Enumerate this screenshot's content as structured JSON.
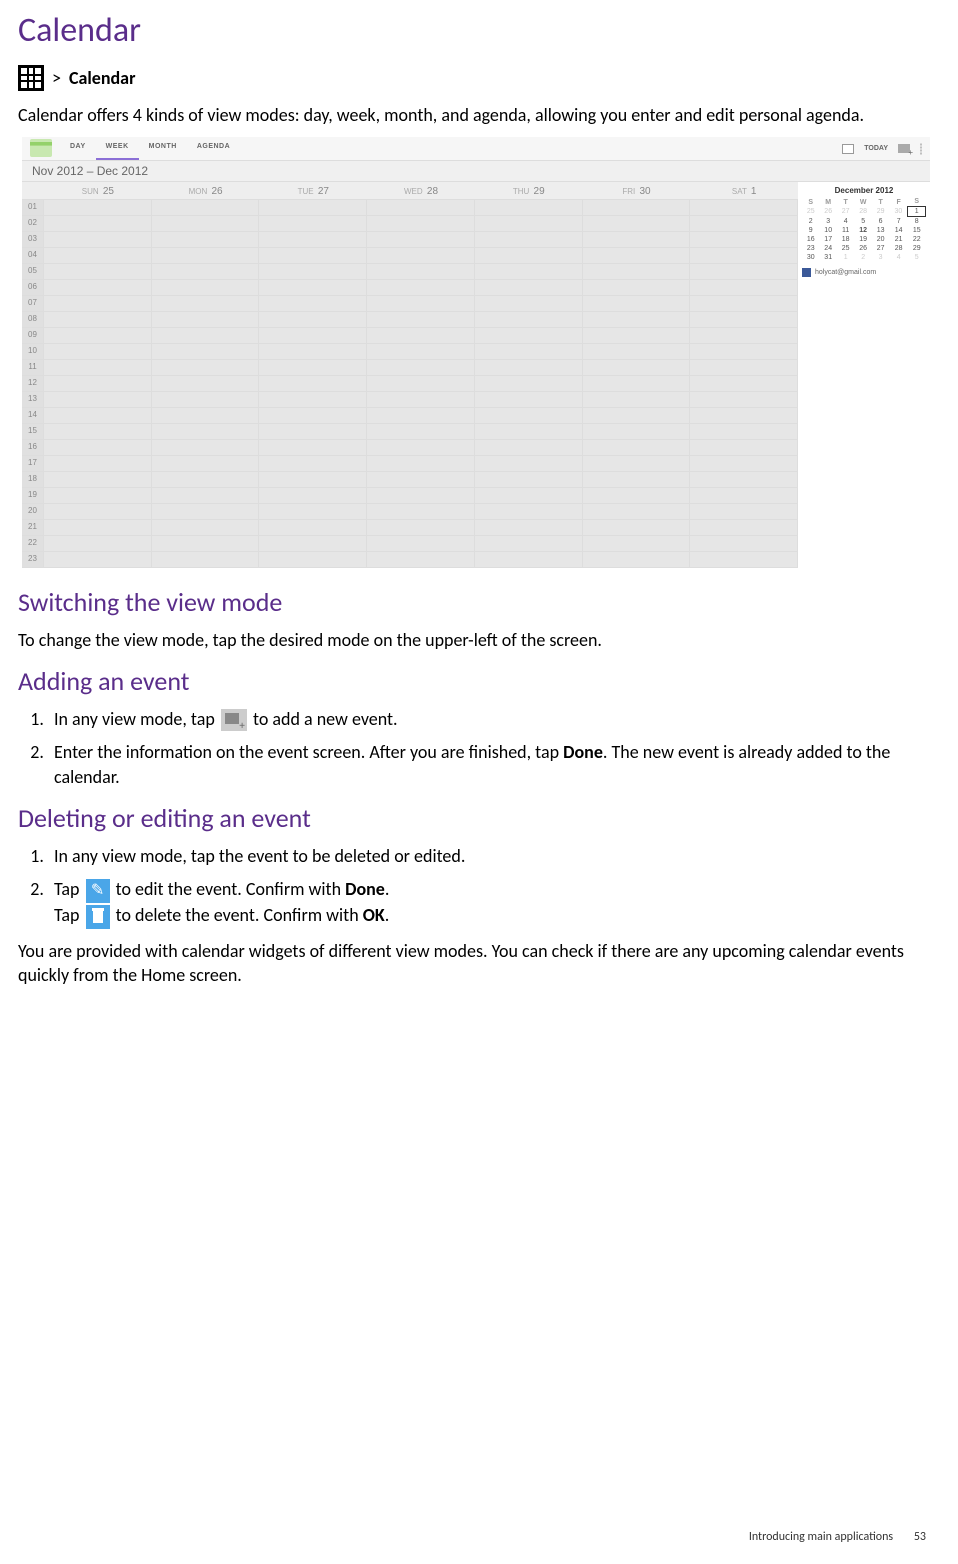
{
  "title": "Calendar",
  "path": {
    "sep": ">",
    "label": "Calendar"
  },
  "intro": "Calendar offers 4 kinds of view modes: day, week, month, and agenda, allowing you enter and edit personal agenda.",
  "screenshot": {
    "tabs": [
      "DAY",
      "WEEK",
      "MONTH",
      "AGENDA"
    ],
    "active_tab_index": 1,
    "today_label": "TODAY",
    "date_range": "Nov 2012 – Dec 2012",
    "days": [
      {
        "dow": "SUN",
        "num": "25"
      },
      {
        "dow": "MON",
        "num": "26"
      },
      {
        "dow": "TUE",
        "num": "27"
      },
      {
        "dow": "WED",
        "num": "28"
      },
      {
        "dow": "THU",
        "num": "29"
      },
      {
        "dow": "FRI",
        "num": "30"
      },
      {
        "dow": "SAT",
        "num": "1"
      }
    ],
    "hours": [
      "01",
      "02",
      "03",
      "04",
      "05",
      "06",
      "07",
      "08",
      "09",
      "10",
      "11",
      "12",
      "13",
      "14",
      "15",
      "16",
      "17",
      "18",
      "19",
      "20",
      "21",
      "22",
      "23"
    ],
    "mini": {
      "title": "December 2012",
      "dow": [
        "S",
        "M",
        "T",
        "W",
        "T",
        "F",
        "S"
      ],
      "rows": [
        [
          {
            "v": "25",
            "dim": true
          },
          {
            "v": "26",
            "dim": true
          },
          {
            "v": "27",
            "dim": true
          },
          {
            "v": "28",
            "dim": true
          },
          {
            "v": "29",
            "dim": true
          },
          {
            "v": "30",
            "dim": true
          },
          {
            "v": "1",
            "sel": true
          }
        ],
        [
          {
            "v": "2"
          },
          {
            "v": "3"
          },
          {
            "v": "4"
          },
          {
            "v": "5"
          },
          {
            "v": "6"
          },
          {
            "v": "7"
          },
          {
            "v": "8"
          }
        ],
        [
          {
            "v": "9"
          },
          {
            "v": "10"
          },
          {
            "v": "11"
          },
          {
            "v": "12",
            "bold": true
          },
          {
            "v": "13"
          },
          {
            "v": "14"
          },
          {
            "v": "15"
          }
        ],
        [
          {
            "v": "16"
          },
          {
            "v": "17"
          },
          {
            "v": "18"
          },
          {
            "v": "19"
          },
          {
            "v": "20"
          },
          {
            "v": "21"
          },
          {
            "v": "22"
          }
        ],
        [
          {
            "v": "23"
          },
          {
            "v": "24"
          },
          {
            "v": "25"
          },
          {
            "v": "26"
          },
          {
            "v": "27"
          },
          {
            "v": "28"
          },
          {
            "v": "29"
          }
        ],
        [
          {
            "v": "30"
          },
          {
            "v": "31"
          },
          {
            "v": "1",
            "dim": true
          },
          {
            "v": "2",
            "dim": true
          },
          {
            "v": "3",
            "dim": true
          },
          {
            "v": "4",
            "dim": true
          },
          {
            "v": "5",
            "dim": true
          }
        ]
      ],
      "account": "holycat@gmail.com"
    }
  },
  "sec_switch": {
    "heading": "Switching the view mode",
    "text": "To change the view mode, tap the desired mode on the upper-left of the screen."
  },
  "sec_add": {
    "heading": "Adding an event",
    "step1_pre": "In any view mode, tap ",
    "step1_post": " to add a new event.",
    "step2_pre": "Enter the information on the event screen. After you are finished, tap ",
    "step2_done": "Done",
    "step2_post": ". The new event is already added to the calendar."
  },
  "sec_del": {
    "heading": "Deleting or editing an event",
    "step1": "In any view mode, tap the event to be deleted or edited.",
    "step2_tap": "Tap ",
    "step2_edit_mid": " to edit the event. Confirm with ",
    "step2_done": "Done",
    "step2_dot": ".",
    "step2_del_mid": " to delete the event. Confirm with ",
    "step2_ok": "OK"
  },
  "widgets_text": "You are provided with calendar widgets of different view modes. You can check if there are any upcoming calendar events quickly from the Home screen.",
  "footer": {
    "section": "Introducing main applications",
    "page": "53"
  }
}
